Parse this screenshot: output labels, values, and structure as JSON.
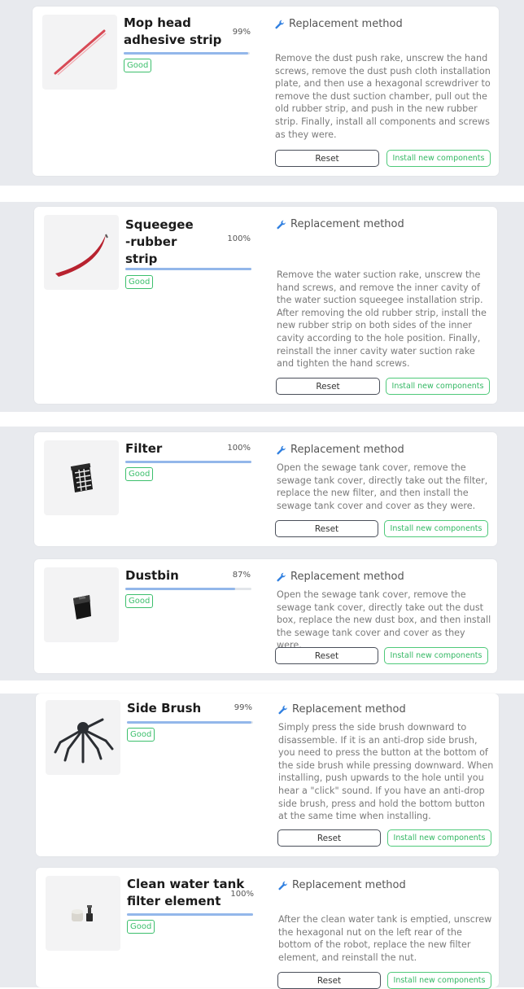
{
  "method_label": "Replacement method",
  "reset_label": "Reset",
  "install_label": "Install new components",
  "status_color": "#3cbf6c",
  "accent_bar_color": "#93b7ea",
  "items": [
    {
      "name_lines": [
        "Mop head",
        "adhesive strip"
      ],
      "percent_text": "99%",
      "percent": 99,
      "status": "Good",
      "icon": "mop-strip-icon",
      "description": "Remove the dust push rake, unscrew the hand screws, remove the dust push cloth installation plate, and then use a hexagonal screwdriver to remove the dust suction chamber, pull out the old rubber strip, and push in the new rubber strip. Finally, install all components and screws as they were."
    },
    {
      "name_lines": [
        "Squeegee",
        "-rubber",
        "strip"
      ],
      "percent_text": "100%",
      "percent": 100,
      "status": "Good",
      "icon": "squeegee-icon",
      "description": "Remove the water suction rake, unscrew the hand screws, and remove the inner cavity of the water suction squeegee installation strip. After removing the old rubber strip, install the new rubber strip on both sides of the inner cavity according to the hole position. Finally, reinstall the inner cavity water suction rake and tighten the hand screws."
    },
    {
      "name_lines": [
        "Filter"
      ],
      "percent_text": "100%",
      "percent": 100,
      "status": "Good",
      "icon": "filter-icon",
      "description": "Open the sewage tank cover, remove the sewage tank cover, directly take out the filter, replace the new filter, and then install the sewage tank cover and cover as they were."
    },
    {
      "name_lines": [
        "Dustbin"
      ],
      "percent_text": "87%",
      "percent": 87,
      "status": "Good",
      "icon": "dustbin-icon",
      "description": "Open the sewage tank cover, remove the sewage tank cover, directly take out the dust box, replace the new dust box, and then install the sewage tank cover and cover as they were."
    },
    {
      "name_lines": [
        "Side Brush"
      ],
      "percent_text": "99%",
      "percent": 99,
      "status": "Good",
      "icon": "side-brush-icon",
      "description": "Simply press the side brush downward to disassemble. If it is an anti-drop side brush, you need to press the button at the bottom of the side brush while pressing downward. When installing, push upwards to the hole until you hear a \"click\" sound. If you have an anti-drop side brush, press and hold the bottom button at the same time when installing."
    },
    {
      "name_lines": [
        "Clean water tank",
        "filter element"
      ],
      "percent_text": "100%",
      "percent": 100,
      "status": "Good",
      "icon": "water-filter-icon",
      "description": "After the clean water tank is emptied, unscrew the hexagonal nut on the left rear of the bottom of the robot, replace the new filter element, and reinstall the nut."
    }
  ]
}
